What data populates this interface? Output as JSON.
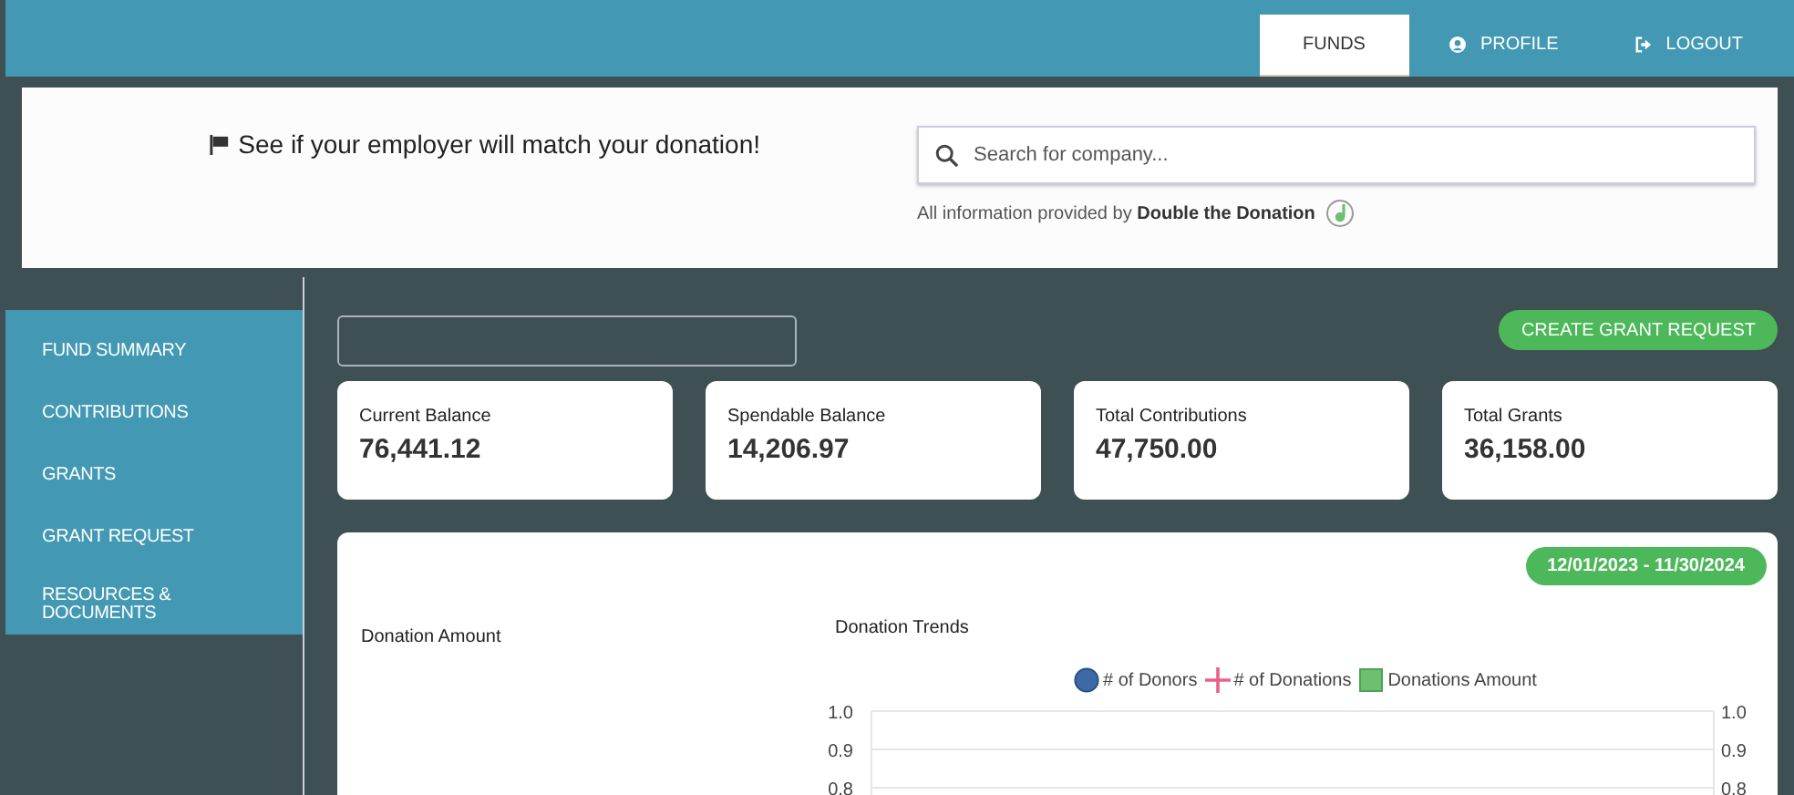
{
  "nav": [
    {
      "label": "FUNDS",
      "selected": true
    },
    {
      "label": "PROFILE",
      "selected": false
    },
    {
      "label": "LOGOUT",
      "selected": false
    }
  ],
  "banner": {
    "message": "See if your employer will match your donation!",
    "search": {
      "placeholder": "Search for company..."
    },
    "credit": "All information provided by **Double the Donation**"
  },
  "sidebar": {
    "items": [
      {
        "label": "FUND SUMMARY"
      },
      {
        "label": "CONTRIBUTIONS"
      },
      {
        "label": "GRANTS"
      },
      {
        "label": "GRANT REQUEST"
      },
      {
        "label": "RESOURCES & DOCUMENTS"
      }
    ]
  },
  "create_button": "CREATE GRANT REQUEST",
  "stats": [
    {
      "label": "Current Balance",
      "value": "76,441.12"
    },
    {
      "label": "Spendable Balance",
      "value": "14,206.97"
    },
    {
      "label": "Total Contributions",
      "value": "47,750.00"
    },
    {
      "label": "Total Grants",
      "value": "36,158.00"
    }
  ],
  "date_range": "12/01/2023 - 11/30/2024",
  "donation_amount": {
    "title": "Donation Amount"
  },
  "trends": {
    "title": "Donation Trends",
    "chart_data": {
      "type": "line",
      "series": [
        {
          "name": "# of Donors",
          "color": "#3d6aa6",
          "marker": "circle"
        },
        {
          "name": "# of Donations",
          "color": "#e8608a",
          "marker": "cross"
        },
        {
          "name": "Donations Amount",
          "color": "#6cc070",
          "marker": "square"
        }
      ],
      "ylim": [
        0.8,
        1.0
      ],
      "yticks": [
        {
          "value": 1.0,
          "label": "1.0"
        },
        {
          "value": 0.9,
          "label": "0.9"
        },
        {
          "value": 0.8,
          "label": "0.8"
        }
      ]
    }
  }
}
